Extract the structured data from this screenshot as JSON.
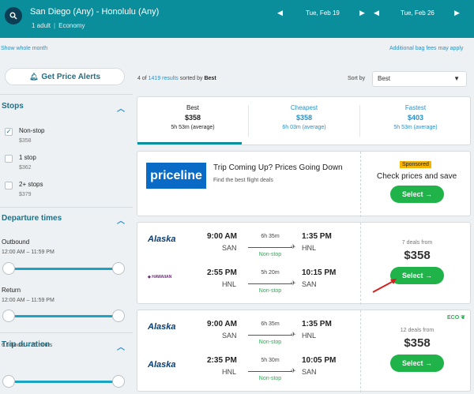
{
  "header": {
    "route": "San Diego (Any) - Honolulu (Any)",
    "adults": "1 adult",
    "cabin": "Economy",
    "depart_date": "Tue, Feb 19",
    "return_date": "Tue, Feb 26"
  },
  "links": {
    "show_whole_month": "Show whole month",
    "bag_fees": "Additional bag fees may apply"
  },
  "alerts_label": "Get Price Alerts",
  "results": {
    "shown": "4 of",
    "total": "1419 results",
    "sorted_by": "sorted by",
    "sort_key": "Best"
  },
  "sort": {
    "label": "Sort by",
    "value": "Best"
  },
  "filters": {
    "stops_title": "Stops",
    "stops": [
      {
        "label": "Non-stop",
        "price": "$358",
        "checked": true
      },
      {
        "label": "1 stop",
        "price": "$362",
        "checked": false
      },
      {
        "label": "2+ stops",
        "price": "$379",
        "checked": false
      }
    ],
    "departure_title": "Departure times",
    "outbound_label": "Outbound",
    "outbound_range": "12:00 AM – 11:59 PM",
    "return_label": "Return",
    "return_range": "12:00 AM – 11:59 PM",
    "duration_title": "Trip duration",
    "duration_range": "6.5 hours – 25 hours"
  },
  "tabs": [
    {
      "title": "Best",
      "price": "$358",
      "time": "5h 53m (average)"
    },
    {
      "title": "Cheapest",
      "price": "$358",
      "time": "6h 03m (average)"
    },
    {
      "title": "Fastest",
      "price": "$403",
      "time": "5h 53m (average)"
    }
  ],
  "ad": {
    "logo": "priceline",
    "title": "Trip Coming Up? Prices Going Down",
    "subtitle": "Find the best flight deals",
    "badge": "Sponsored",
    "cta_text": "Check prices and save",
    "button": "Select"
  },
  "results_list": [
    {
      "out": {
        "airline": "Alaska",
        "dep_time": "9:00 AM",
        "dep_ap": "SAN",
        "duration": "6h 35m",
        "stops": "Non-stop",
        "arr_time": "1:35 PM",
        "arr_ap": "HNL"
      },
      "ret": {
        "airline": "Hawaiian",
        "dep_time": "2:55 PM",
        "dep_ap": "HNL",
        "duration": "5h 20m",
        "stops": "Non-stop",
        "arr_time": "10:15 PM",
        "arr_ap": "SAN"
      },
      "deals": "7 deals from",
      "price": "$358",
      "button": "Select"
    },
    {
      "out": {
        "airline": "Alaska",
        "dep_time": "9:00 AM",
        "dep_ap": "SAN",
        "duration": "6h 35m",
        "stops": "Non-stop",
        "arr_time": "1:35 PM",
        "arr_ap": "HNL"
      },
      "ret": {
        "airline": "Alaska",
        "dep_time": "2:35 PM",
        "dep_ap": "HNL",
        "duration": "5h 30m",
        "stops": "Non-stop",
        "arr_time": "10:05 PM",
        "arr_ap": "SAN"
      },
      "deals": "12 deals from",
      "price": "$358",
      "button": "Select",
      "eco": "ECO"
    }
  ],
  "colors": {
    "header": "#0a8e9c",
    "accent": "#2a8fc7",
    "select": "#1fb34a",
    "tab_underline": "#0a8e9c"
  }
}
